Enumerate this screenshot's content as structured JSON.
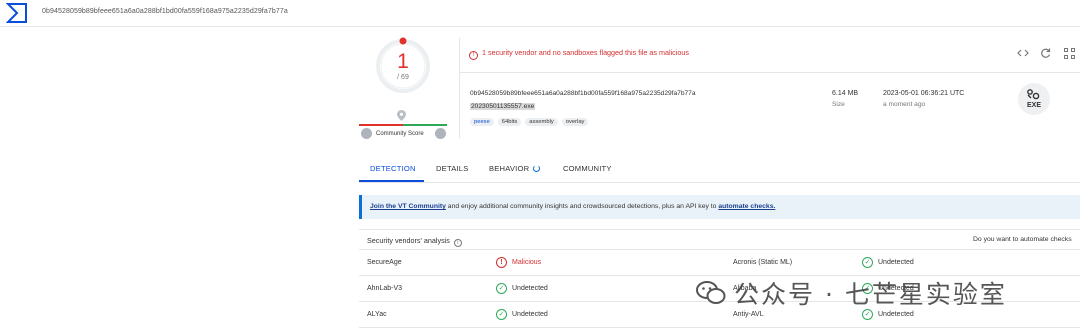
{
  "search": {
    "hash": "0b94528059b89bfeee651a6a0a288bf1bd00fa559f168a975a2235d29fa7b77a"
  },
  "score": {
    "detections": "1",
    "total": "/ 69"
  },
  "community": {
    "label": "Community Score"
  },
  "alert": {
    "text": "1 security vendor and no sandboxes flagged this file as malicious"
  },
  "file": {
    "hash": "0b94528059b89bfeee651a6a0a288bf1bd00fa559f168a975a2235d29fa7b77a",
    "name": "20230501135557.exe",
    "tags": [
      "peexe",
      "64bits",
      "assembly",
      "overlay"
    ],
    "size_value": "6.14 MB",
    "size_label": "Size",
    "date_value": "2023-05-01 06:36:21 UTC",
    "date_label": "a moment ago",
    "type_label": "EXE"
  },
  "tabs": [
    "DETECTION",
    "DETAILS",
    "BEHAVIOR",
    "COMMUNITY"
  ],
  "banner": {
    "link1": "Join the VT Community",
    "middle": " and enjoy additional community insights and crowdsourced detections, plus an API key to ",
    "link2": "automate checks."
  },
  "vendors": {
    "title": "Security vendors' analysis",
    "automate_prompt": "Do you want to automate checks",
    "rows": [
      {
        "left_vendor": "SecureAge",
        "left_status": "Malicious",
        "right_vendor": "Acronis (Static ML)",
        "right_status": "Undetected"
      },
      {
        "left_vendor": "AhnLab-V3",
        "left_status": "Undetected",
        "right_vendor": "Alibaba",
        "right_status": "Undetected"
      },
      {
        "left_vendor": "ALYac",
        "left_status": "Undetected",
        "right_vendor": "Antiy-AVL",
        "right_status": "Undetected"
      }
    ]
  },
  "watermark": {
    "text": "公众号 · 七芒星实验室"
  },
  "colors": {
    "accent": "#0b4dda",
    "malicious": "#d32f2f",
    "clean": "#2fa85b",
    "banner_bg": "#e9f2f9"
  },
  "icons": [
    "virustotal-logo",
    "location-pin-icon",
    "thumbs-down-icon",
    "thumbs-up-icon",
    "alert-icon",
    "code-compare-icon",
    "refresh-icon",
    "graph-icon",
    "exe-file-icon",
    "info-icon",
    "malicious-icon",
    "undetected-icon",
    "spinner-icon"
  ]
}
